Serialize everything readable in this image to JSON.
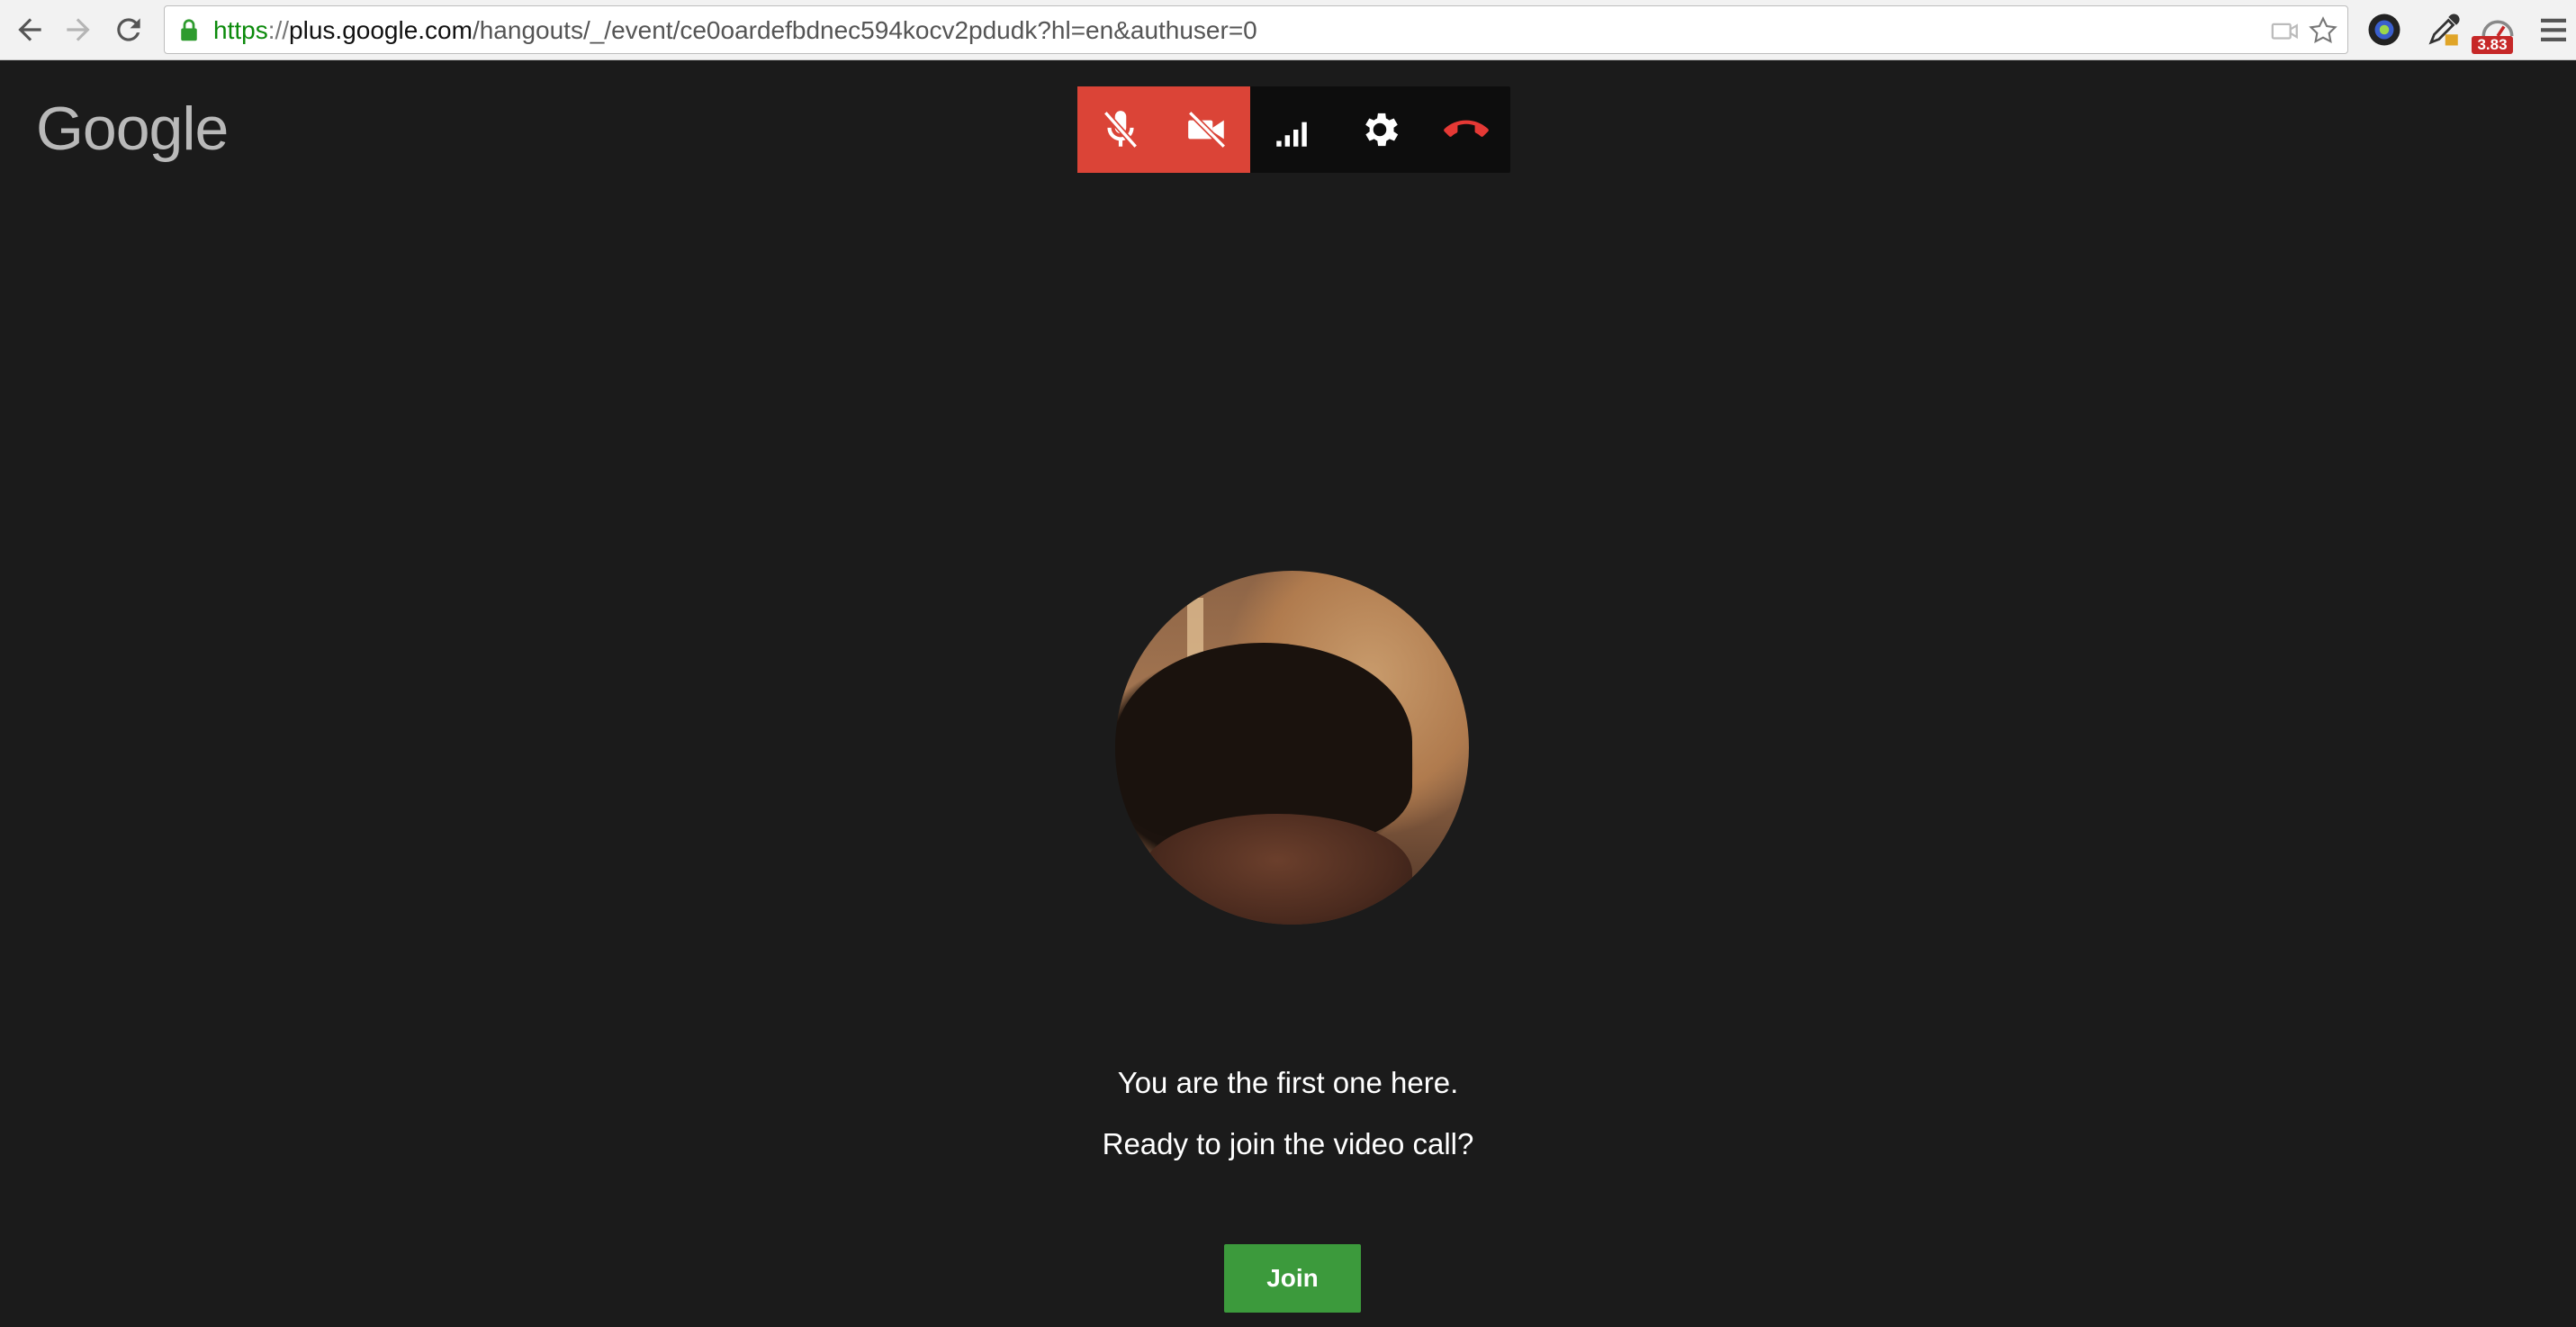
{
  "browser": {
    "url": {
      "scheme": "https",
      "separator": "://",
      "host": "plus.google.com",
      "path": "/hangouts/_/event/ce0oardefbdnec594kocv2pdudk?hl=en&authuser=0"
    },
    "extension_badge": "3.83",
    "icons": [
      "back-icon",
      "forward-icon",
      "reload-icon",
      "lock-icon",
      "camera-blocked-icon",
      "bookmark-star-icon",
      "camera-extension-icon",
      "eyedropper-icon",
      "speedometer-icon",
      "menu-icon"
    ]
  },
  "page": {
    "logo_text": "Google",
    "controls": [
      {
        "name": "mute-mic",
        "icon": "mic-off-icon",
        "active": true
      },
      {
        "name": "video-off",
        "icon": "video-off-icon",
        "active": true
      },
      {
        "name": "bandwidth",
        "icon": "signal-bars-icon",
        "active": false
      },
      {
        "name": "settings",
        "icon": "gear-icon",
        "active": false
      },
      {
        "name": "hang-up",
        "icon": "hang-up-icon",
        "active": false
      }
    ],
    "message_line1": "You are the first one here.",
    "message_line2": "Ready to join the video call?",
    "join_label": "Join"
  },
  "colors": {
    "background": "#1b1b1b",
    "control_active": "#db4437",
    "join_button": "#3c9a3c",
    "hang_up": "#e53935"
  }
}
